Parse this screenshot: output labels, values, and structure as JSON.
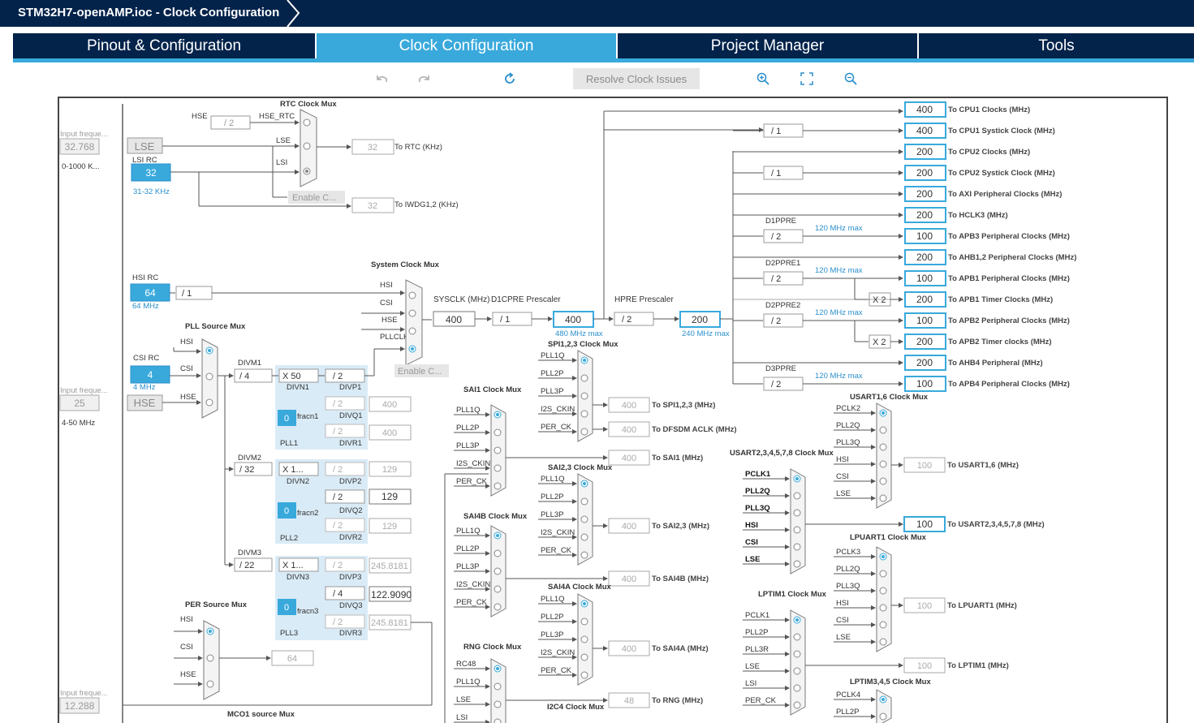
{
  "title": "STM32H7-openAMP.ioc - Clock Configuration",
  "tabs": [
    {
      "label": "Pinout & Configuration"
    },
    {
      "label": "Clock Configuration"
    },
    {
      "label": "Project Manager"
    },
    {
      "label": "Tools"
    }
  ],
  "toolbar": {
    "undo_icon": "undo-icon",
    "redo_icon": "redo-icon",
    "refresh_icon": "refresh-icon",
    "resolve_label": "Resolve Clock Issues",
    "zoom_in_icon": "zoom-in-icon",
    "fit_icon": "fit-icon",
    "zoom_out_icon": "zoom-out-icon"
  },
  "inputs": {
    "lse_freq_label": "Input freque...",
    "lse_freq": "32.768",
    "lse_range": "0-1000 K...",
    "hse_freq_label": "Input freque...",
    "hse_freq": "25",
    "hse_range": "4-50 MHz",
    "ext_freq_label": "Input freque...",
    "ext_freq": "12.288"
  },
  "oscillators": {
    "lse": "LSE",
    "lsi_label": "LSI RC",
    "lsi_value": "32",
    "lsi_range": "31-32 KHz",
    "hsi_label": "HSI RC",
    "hsi_value": "64",
    "hsi_range": "64 MHz",
    "csi_label": "CSI RC",
    "csi_value": "4",
    "csi_range": "4 MHz",
    "hse": "HSE"
  },
  "rtc": {
    "mux_title": "RTC Clock Mux",
    "hse_label": "HSE",
    "hse_div": "/ 2",
    "hse_rtc": "HSE_RTC",
    "lse": "LSE",
    "lsi": "LSI",
    "enable": "Enable C...",
    "rtc_value": "32",
    "rtc_label": "To RTC (KHz)",
    "iwdg_value": "32",
    "iwdg_label": "To IWDG1,2 (KHz)"
  },
  "hsi_div": "/ 1",
  "sysmux": {
    "title": "System Clock Mux",
    "hsi": "HSI",
    "csi": "CSI",
    "hse": "HSE",
    "pllclk": "PLLCLK",
    "enable": "Enable C...",
    "sysclk_label": "SYSCLK (MHz)",
    "sysclk_value": "400",
    "d1cpre_label": "D1CPRE Prescaler",
    "d1cpre": "/ 1",
    "cpu_value": "400",
    "cpu_max": "480 MHz max",
    "hpre_label": "HPRE Prescaler",
    "hpre": "/ 2",
    "hclk_value": "200",
    "hclk_max": "240 MHz max"
  },
  "pll_source": {
    "title": "PLL Source Mux",
    "hsi": "HSI",
    "csi": "CSI",
    "hse": "HSE"
  },
  "pll1": {
    "divm_label": "DIVM1",
    "divm": "/ 4",
    "divn": "X 50",
    "divn_label": "DIVN1",
    "divp": "/ 2",
    "divp_label": "DIVP1",
    "divq": "/ 2",
    "divq_label": "DIVQ1",
    "q_out": "400",
    "frac": "0",
    "frac_label": "fracn1",
    "divr": "/ 2",
    "divr_label": "DIVR1",
    "r_out": "400",
    "name": "PLL1"
  },
  "pll2": {
    "divm_label": "DIVM2",
    "divm": "/ 32",
    "divn": "X 1...",
    "divn_label": "DIVN2",
    "divp": "/ 2",
    "divp_label": "DIVP2",
    "p_out": "129",
    "divq": "/ 2",
    "divq_label": "DIVQ2",
    "q_out": "129",
    "frac": "0",
    "frac_label": "fracn2",
    "divr": "/ 2",
    "divr_label": "DIVR2",
    "r_out": "129",
    "name": "PLL2"
  },
  "pll3": {
    "divm_label": "DIVM3",
    "divm": "/ 22",
    "divn": "X 1...",
    "divn_label": "DIVN3",
    "divp": "/ 2",
    "divp_label": "DIVP3",
    "p_out": "245.8181",
    "divq": "/ 4",
    "divq_label": "DIVQ3",
    "q_out": "122.9090",
    "frac": "0",
    "frac_label": "fracn3",
    "divr": "/ 2",
    "divr_label": "DIVR3",
    "r_out": "245.8181",
    "name": "PLL3"
  },
  "per": {
    "title": "PER Source Mux",
    "hsi": "HSI",
    "csi": "CSI",
    "hse": "HSE",
    "value": "64"
  },
  "mco": {
    "title": "MCO1 source Mux"
  },
  "outputs": [
    {
      "value": "400",
      "label": "To CPU1 Clocks (MHz)"
    },
    {
      "value": "400",
      "label": "To CPU1 Systick Clock (MHz)",
      "div": "/ 1"
    },
    {
      "value": "200",
      "label": "To CPU2 Clocks (MHz)"
    },
    {
      "value": "200",
      "label": "To CPU2 Systick Clock (MHz)",
      "div": "/ 1"
    },
    {
      "value": "200",
      "label": "To AXI Peripheral Clocks (MHz)"
    },
    {
      "value": "200",
      "label": "To HCLK3 (MHz)"
    },
    {
      "value": "100",
      "label": "To APB3 Peripheral Clocks (MHz)",
      "pre": "D1PPRE",
      "div": "/ 2",
      "max": "120 MHz max"
    },
    {
      "value": "200",
      "label": "To AHB1,2 Peripheral Clocks (MHz)"
    },
    {
      "value": "100",
      "label": "To APB1 Peripheral Clocks (MHz)",
      "pre": "D2PPRE1",
      "div": "/ 2",
      "max": "120 MHz max"
    },
    {
      "value": "200",
      "label": "To APB1 Timer Clocks (MHz)",
      "mul": "X 2"
    },
    {
      "value": "100",
      "label": "To APB2 Peripheral Clocks (MHz)",
      "pre": "D2PPRE2",
      "div": "/ 2",
      "max": "120 MHz max"
    },
    {
      "value": "200",
      "label": "To APB2 Timer clocks (MHz)",
      "mul": "X 2"
    },
    {
      "value": "200",
      "label": "To AHB4 Peripheral (MHz)"
    },
    {
      "value": "100",
      "label": "To APB4 Peripheral Clocks (MHz)",
      "pre": "D3PPRE",
      "div": "/ 2",
      "max": "120 MHz max"
    }
  ],
  "spi": {
    "title": "SPI1,2,3 Clock Mux",
    "inputs": [
      "PLL1Q",
      "PLL2P",
      "PLL3P",
      "I2S_CKIN",
      "PER_CK"
    ],
    "value": "400",
    "label": "To SPI1,2,3 (MHz)",
    "dfsdm_value": "400",
    "dfsdm_label": "To DFSDM ACLK (MHz)"
  },
  "sai1": {
    "title": "SAI1 Clock Mux",
    "inputs": [
      "PLL1Q",
      "PLL2P",
      "PLL3P",
      "I2S_CKIN",
      "PER_CK"
    ],
    "value": "400",
    "label": "To SAI1 (MHz)"
  },
  "sai23": {
    "title": "SAI2,3 Clock Mux",
    "inputs": [
      "PLL1Q",
      "PLL2P",
      "PLL3P",
      "I2S_CKIN",
      "PER_CK"
    ],
    "value": "400",
    "label": "To SAI2,3 (MHz)"
  },
  "sai4b": {
    "title": "SAI4B Clock Mux",
    "inputs": [
      "PLL1Q",
      "PLL2P",
      "PLL3P",
      "I2S_CKIN",
      "PER_CK"
    ],
    "value": "400",
    "label": "To SAI4B (MHz)"
  },
  "sai4a": {
    "title": "SAI4A Clock Mux",
    "inputs": [
      "PLL1Q",
      "PLL2P",
      "PLL3P",
      "I2S_CKIN",
      "PER_CK"
    ],
    "value": "400",
    "label": "To SAI4A (MHz)"
  },
  "rng": {
    "title": "RNG Clock Mux",
    "inputs": [
      "RC48",
      "PLL1Q",
      "LSE",
      "LSI"
    ],
    "value": "48",
    "label": "To RNG (MHz)"
  },
  "i2c4": {
    "title": "I2C4 Clock Mux"
  },
  "usart16": {
    "title": "USART1,6 Clock Mux",
    "inputs": [
      "PCLK2",
      "PLL2Q",
      "PLL3Q",
      "HSI",
      "CSI",
      "LSE"
    ],
    "value": "100",
    "label": "To USART1,6 (MHz)"
  },
  "usart2": {
    "title": "USART2,3,4,5,7,8 Clock Mux",
    "inputs": [
      "PCLK1",
      "PLL2Q",
      "PLL3Q",
      "HSI",
      "CSI",
      "LSE"
    ],
    "value": "100",
    "label": "To USART2,3,4,5,7,8 (MHz)"
  },
  "lpuart": {
    "title": "LPUART1 Clock Mux",
    "inputs": [
      "PCLK3",
      "PLL2Q",
      "PLL3Q",
      "HSI",
      "CSI",
      "LSE"
    ],
    "value": "100",
    "label": "To LPUART1 (MHz)"
  },
  "lptim1": {
    "title": "LPTIM1 Clock Mux",
    "inputs": [
      "PCLK1",
      "PLL2P",
      "PLL3R",
      "LSE",
      "LSI",
      "PER_CK"
    ],
    "value": "100",
    "label": "To LPTIM1 (MHz)"
  },
  "lptim345": {
    "title": "LPTIM3,4,5 Clock Mux",
    "inputs": [
      "PCLK4",
      "PLL2P"
    ]
  }
}
